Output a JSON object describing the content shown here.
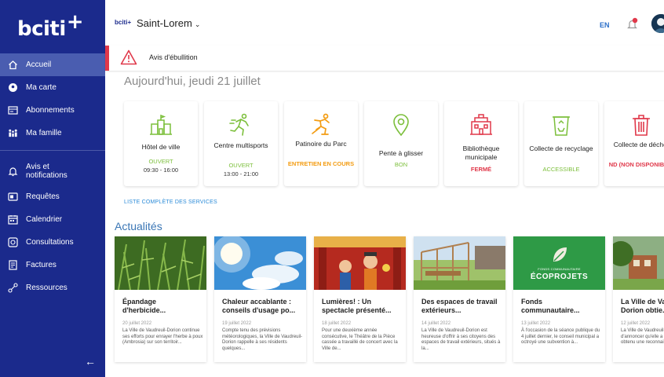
{
  "sidebar": {
    "logo_text": "bciti",
    "logo_plus": "+",
    "items": [
      {
        "label": "Accueil",
        "icon": "home-icon"
      },
      {
        "label": "Ma carte",
        "icon": "map-pin-icon"
      },
      {
        "label": "Abonnements",
        "icon": "subscription-icon"
      },
      {
        "label": "Ma famille",
        "icon": "family-icon"
      },
      {
        "label": "Avis et notifications",
        "icon": "bell-icon"
      },
      {
        "label": "Requêtes",
        "icon": "request-icon"
      },
      {
        "label": "Calendrier",
        "icon": "calendar-icon"
      },
      {
        "label": "Consultations",
        "icon": "consultation-icon"
      },
      {
        "label": "Factures",
        "icon": "invoice-icon"
      },
      {
        "label": "Ressources",
        "icon": "resources-icon"
      }
    ],
    "collapse_label": "←"
  },
  "header": {
    "small_logo": "bciti+",
    "city": "Saint-Lorem",
    "lang": "EN"
  },
  "alert": {
    "text": "Avis d'ébullition",
    "color": "#e0384a"
  },
  "today": "Aujourd'hui, jeudi 21 juillet",
  "services": [
    {
      "name": "Hôtel de ville",
      "status": "OUVERT",
      "hours": "09:30 - 16:00",
      "status_color": "#7cbf3b",
      "icon": "city-hall-icon"
    },
    {
      "name": "Centre multisports",
      "status": "OUVERT",
      "hours": "13:00 - 21:00",
      "status_color": "#7cbf3b",
      "icon": "runner-icon"
    },
    {
      "name": "Patinoire du Parc",
      "status": "ENTRETIEN EN COURS",
      "hours": "",
      "status_color": "#f39c12",
      "icon": "skater-icon"
    },
    {
      "name": "Pente à glisser",
      "status": "BON",
      "hours": "",
      "status_color": "#7cbf3b",
      "icon": "location-icon"
    },
    {
      "name": "Bibliothèque municipale",
      "status": "FERMÉ",
      "hours": "",
      "status_color": "#e0384a",
      "icon": "library-icon"
    },
    {
      "name": "Collecte de recyclage",
      "status": "ACCESSIBLE",
      "hours": "",
      "status_color": "#7cbf3b",
      "icon": "recycle-icon"
    },
    {
      "name": "Collecte de déchet",
      "status": "ND (NON DISPONIBLE)",
      "hours": "",
      "status_color": "#e0384a",
      "icon": "trash-icon"
    }
  ],
  "all_services_link": "LISTE COMPLÈTE DES SERVICES",
  "news_title": "Actualités",
  "news": [
    {
      "title": "Épandage d'herbicide...",
      "date": "20 juillet 2022",
      "excerpt": "La Ville de Vaudreuil-Dorion continue ses efforts pour enrayer l'herbe à poux (Ambrosia) sur son territoir..."
    },
    {
      "title": "Chaleur accablante : conseils d'usage po...",
      "date": "19 juillet 2022",
      "excerpt": "Compte tenu des prévisions météorologiques, la Ville de Vaudreuil-Dorion rappelle à ses résidents quelques..."
    },
    {
      "title": "Lumières! : Un spectacle présenté...",
      "date": "18 juillet 2022",
      "excerpt": "Pour une deuxième année consécutive, le Théâtre de la Pièce cassée a travaillé de concert avec la Ville de..."
    },
    {
      "title": "Des espaces de travail extérieurs...",
      "date": "14 juillet 2022",
      "excerpt": "La Ville de Vaudreuil-Dorion est heureuse d'offrir à ses citoyens des espaces de travail extérieurs, situés à la..."
    },
    {
      "title": "Fonds communautaire...",
      "date": "13 juillet 2022",
      "excerpt": "À l'occasion de la séance publique du 4 juillet dernier, le conseil municipal a octroyé une subvention à...",
      "img_caption_small": "FONDS COMMUNAUTAIRE",
      "img_caption_big": "ÉCOPROJETS"
    },
    {
      "title": "La Ville de Vaudreuil-Dorion obtie...",
      "date": "12 juillet 2022",
      "excerpt": "La Ville de Vaudreuil-Dorion est fière d'annoncer qu'elle a récemment obtenu une reconnaissance..."
    }
  ],
  "colors": {
    "sidebar": "#1b2a8c",
    "active": "#4a5db0",
    "link": "#2b8bd8",
    "heading": "#3a76b5"
  }
}
